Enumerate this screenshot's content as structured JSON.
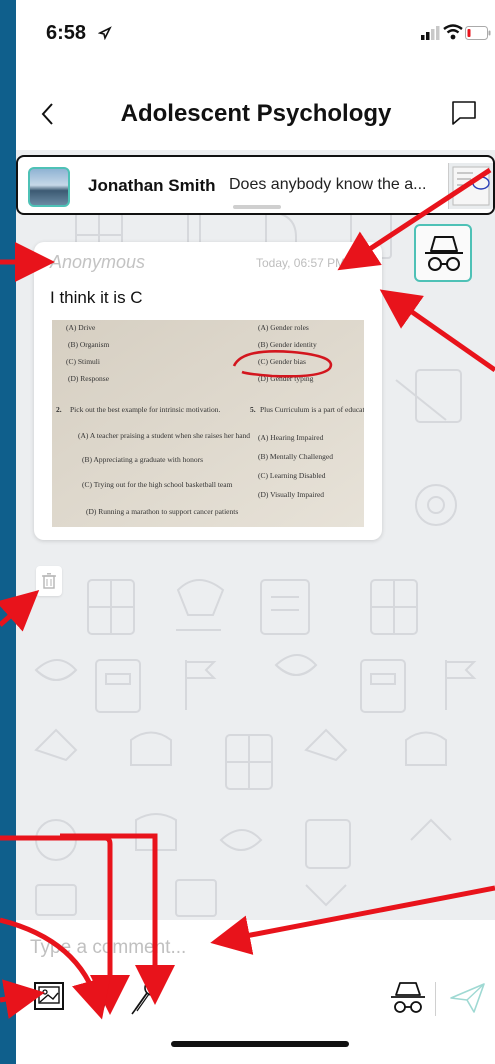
{
  "status_bar": {
    "time": "6:58"
  },
  "nav": {
    "title": "Adolescent Psychology"
  },
  "pinned": {
    "name": "Jonathan Smith",
    "preview": "Does anybody know the a..."
  },
  "post": {
    "author": "Anonymous",
    "timestamp": "Today, 06:57 PM",
    "more_label": "ooo",
    "message": "I think it is C",
    "photo_text": {
      "left_options": [
        "(A) Drive",
        "(B) Organism",
        "(C) Stimuli",
        "(D) Response"
      ],
      "right_options": [
        "(A) Gender roles",
        "(B) Gender identity",
        "(C) Gender bias",
        "(D) Gender typing"
      ],
      "q2": "Pick out the best example for intrinsic motivation.",
      "q2_num": "2.",
      "q2_options": [
        "(A) A teacher praising a student when she raises her hand",
        "(B) Appreciating a graduate with honors",
        "(C) Trying out for the high school basketball team",
        "(D) Running a marathon to support cancer patients"
      ],
      "q5": "Plus Curriculum is a part of educatin the :",
      "q5_num": "5.",
      "q5_options": [
        "(A) Hearing Impaired",
        "(B) Mentally Challenged",
        "(C) Learning Disabled",
        "(D) Visually Impaired"
      ]
    }
  },
  "composer": {
    "placeholder": "Type a comment..."
  },
  "colors": {
    "accent": "#4ec1b6",
    "frame": "#0f5f8c",
    "annotation": "#e8131b"
  }
}
